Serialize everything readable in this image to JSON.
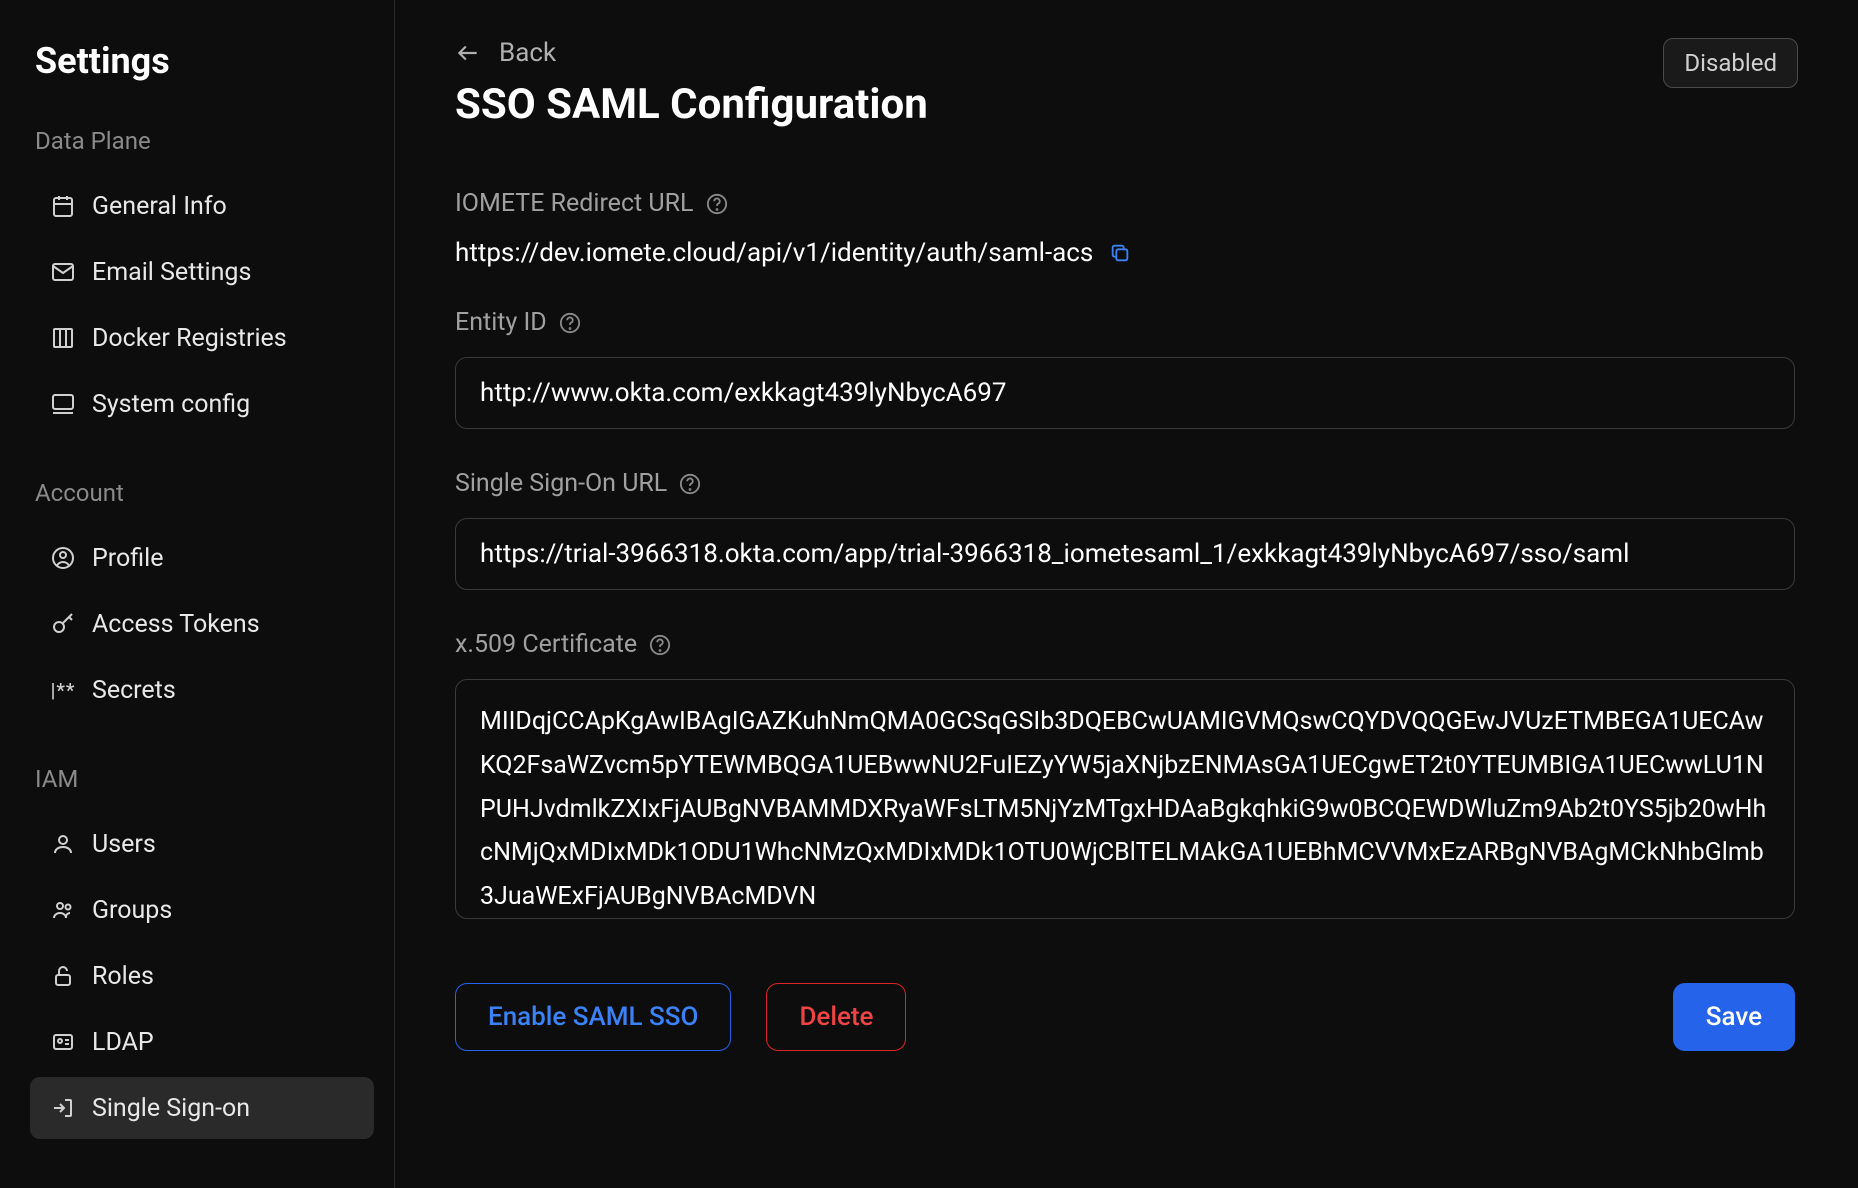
{
  "sidebar": {
    "title": "Settings",
    "sections": [
      {
        "label": "Data Plane",
        "items": [
          {
            "label": "General Info",
            "icon": "calendar"
          },
          {
            "label": "Email Settings",
            "icon": "mail"
          },
          {
            "label": "Docker Registries",
            "icon": "columns"
          },
          {
            "label": "System config",
            "icon": "monitor"
          }
        ]
      },
      {
        "label": "Account",
        "items": [
          {
            "label": "Profile",
            "icon": "user-circle"
          },
          {
            "label": "Access Tokens",
            "icon": "key"
          },
          {
            "label": "Secrets",
            "icon": "secrets"
          }
        ]
      },
      {
        "label": "IAM",
        "items": [
          {
            "label": "Users",
            "icon": "user"
          },
          {
            "label": "Groups",
            "icon": "users"
          },
          {
            "label": "Roles",
            "icon": "unlock"
          },
          {
            "label": "LDAP",
            "icon": "id-card"
          },
          {
            "label": "Single Sign-on",
            "icon": "login",
            "active": true
          }
        ]
      }
    ]
  },
  "header": {
    "back_label": "Back",
    "title": "SSO SAML Configuration",
    "status": "Disabled"
  },
  "form": {
    "redirect_url": {
      "label": "IOMETE Redirect URL",
      "value": "https://dev.iomete.cloud/api/v1/identity/auth/saml-acs"
    },
    "entity_id": {
      "label": "Entity ID",
      "value": "http://www.okta.com/exkkagt439lyNbycA697"
    },
    "sso_url": {
      "label": "Single Sign-On URL",
      "value": "https://trial-3966318.okta.com/app/trial-3966318_iometesaml_1/exkkagt439lyNbycA697/sso/saml"
    },
    "certificate": {
      "label": "x.509 Certificate",
      "value": "MIIDqjCCApKgAwIBAgIGAZKuhNmQMA0GCSqGSIb3DQEBCwUAMIGVMQswCQYDVQQGEwJVUzETMBEGA1UECAwKQ2FsaWZvcm5pYTEWMBQGA1UEBwwNU2FuIEZyYW5jaXNjbzENMAsGA1UECgwET2t0YTEUMBIGA1UECwwLU1NPUHJvdmlkZXIxFjAUBgNVBAMMDXRyaWFsLTM5NjYzMTgxHDAaBgkqhkiG9w0BCQEWDWluZm9Ab2t0YS5jb20wHhcNMjQxMDIxMDk1ODU1WhcNMzQxMDIxMDk1OTU0WjCBlTELMAkGA1UEBhMCVVMxEzARBgNVBAgMCkNhbGlmb3JuaWExFjAUBgNVBAcMDVN"
    }
  },
  "buttons": {
    "enable": "Enable SAML SSO",
    "delete": "Delete",
    "save": "Save"
  }
}
